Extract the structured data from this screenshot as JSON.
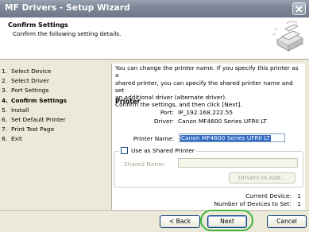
{
  "window": {
    "title": "MF Drivers - Setup Wizard"
  },
  "header": {
    "title": "Confirm Settings",
    "subtitle": "Confirm the following setting details."
  },
  "steps": [
    {
      "num": "1.",
      "label": "Select Device"
    },
    {
      "num": "2.",
      "label": "Select Driver"
    },
    {
      "num": "3.",
      "label": "Port Settings"
    },
    {
      "num": "4.",
      "label": "Confirm Settings",
      "current": true
    },
    {
      "num": "5.",
      "label": "Install"
    },
    {
      "num": "6.",
      "label": "Set Default Printer"
    },
    {
      "num": "7.",
      "label": "Print Test Page"
    },
    {
      "num": "8.",
      "label": "Exit"
    }
  ],
  "panel": {
    "intro_lines": [
      "You can change the printer name. If you specify this printer as a",
      "shared printer, you can specify the shared printer name and set",
      "an additional driver (alternate driver).",
      "Confirm the settings, and then click [Next]."
    ],
    "section_title": "Printer",
    "port_label": "Port:",
    "port_value": "IP_192.168.222.55",
    "driver_label": "Driver:",
    "driver_value": "Canon MF4600 Series UFRII LT",
    "printer_name_label": "Printer Name:",
    "printer_name_value": "Canon MF4600 Series UFRII LT",
    "shared_checkbox_label": "Use as Shared Printer",
    "shared_name_label": "Shared Name:",
    "drivers_button": "Drivers to Add...",
    "current_device_label": "Current Device:",
    "current_device_value": "1",
    "devices_to_set_label": "Number of Devices to Set:",
    "devices_to_set_value": "1"
  },
  "buttons": {
    "back": "< Back",
    "next": "Next",
    "cancel": "Cancel"
  },
  "colors": {
    "titlebar": "#7e8797",
    "highlight_circle": "#3cb63c",
    "selection": "#316ac5"
  }
}
